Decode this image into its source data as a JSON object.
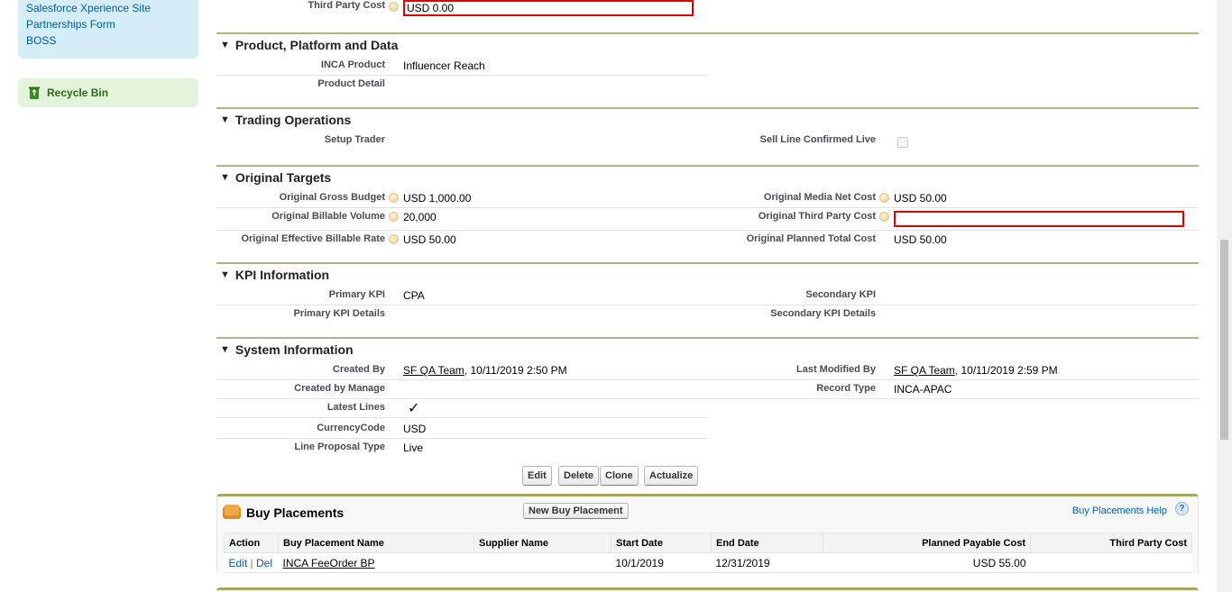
{
  "sidebar": {
    "links": [
      "Salesforce Xperience Site",
      "Partnerships Form",
      "BOSS"
    ],
    "recycle_bin": "Recycle Bin"
  },
  "top": {
    "third_party_cost_label": "Third Party Cost",
    "third_party_cost_value": "USD 0.00"
  },
  "sections": {
    "product": {
      "title": "Product, Platform and Data",
      "inca_product_label": "INCA Product",
      "inca_product_value": "Influencer Reach",
      "product_detail_label": "Product Detail"
    },
    "trading": {
      "title": "Trading Operations",
      "setup_trader_label": "Setup Trader",
      "sell_line_label": "Sell Line Confirmed Live"
    },
    "targets": {
      "title": "Original Targets",
      "gross_budget_label": "Original Gross Budget",
      "gross_budget_value": "USD 1,000.00",
      "media_net_cost_label": "Original Media Net Cost",
      "media_net_cost_value": "USD 50.00",
      "billable_volume_label": "Original Billable Volume",
      "billable_volume_value": "20,000",
      "third_party_cost_label": "Original Third Party Cost",
      "third_party_cost_value": "",
      "effective_rate_label": "Original Effective Billable Rate",
      "effective_rate_value": "USD 50.00",
      "planned_total_label": "Original Planned Total Cost",
      "planned_total_value": "USD 50.00"
    },
    "kpi": {
      "title": "KPI Information",
      "primary_label": "Primary KPI",
      "primary_value": "CPA",
      "secondary_label": "Secondary KPI",
      "primary_details_label": "Primary KPI Details",
      "secondary_details_label": "Secondary KPI Details"
    },
    "system": {
      "title": "System Information",
      "created_by_label": "Created By",
      "created_by_user": "SF QA Team",
      "created_by_date": ", 10/11/2019 2:50 PM",
      "modified_by_label": "Last Modified By",
      "modified_by_user": "SF QA Team",
      "modified_by_date": ", 10/11/2019 2:59 PM",
      "created_by_manage_label": "Created by Manage",
      "record_type_label": "Record Type",
      "record_type_value": "INCA-APAC",
      "latest_lines_label": "Latest Lines",
      "latest_lines_value": "✓",
      "currency_label": "CurrencyCode",
      "currency_value": "USD",
      "proposal_type_label": "Line Proposal Type",
      "proposal_type_value": "Live"
    }
  },
  "buttons": {
    "edit": "Edit",
    "delete": "Delete",
    "clone": "Clone",
    "actualize": "Actualize"
  },
  "buy_placements": {
    "title": "Buy Placements",
    "new_button": "New Buy Placement",
    "help_link": "Buy Placements Help",
    "help_icon": "?",
    "columns": [
      "Action",
      "Buy Placement Name",
      "Supplier Name",
      "Start Date",
      "End Date",
      "Planned Payable Cost",
      "Third Party Cost"
    ],
    "rows": [
      {
        "edit": "Edit",
        "sep": " | ",
        "del": "Del",
        "name": "INCA FeeOrder BP",
        "supplier": "",
        "start": "10/1/2019",
        "end": "12/31/2019",
        "planned": "USD 55.00",
        "third_party": ""
      }
    ]
  },
  "icons": {
    "recycle": "recycle-bin-icon",
    "help": "help-bubble-icon",
    "related": "buy-placement-icon"
  }
}
